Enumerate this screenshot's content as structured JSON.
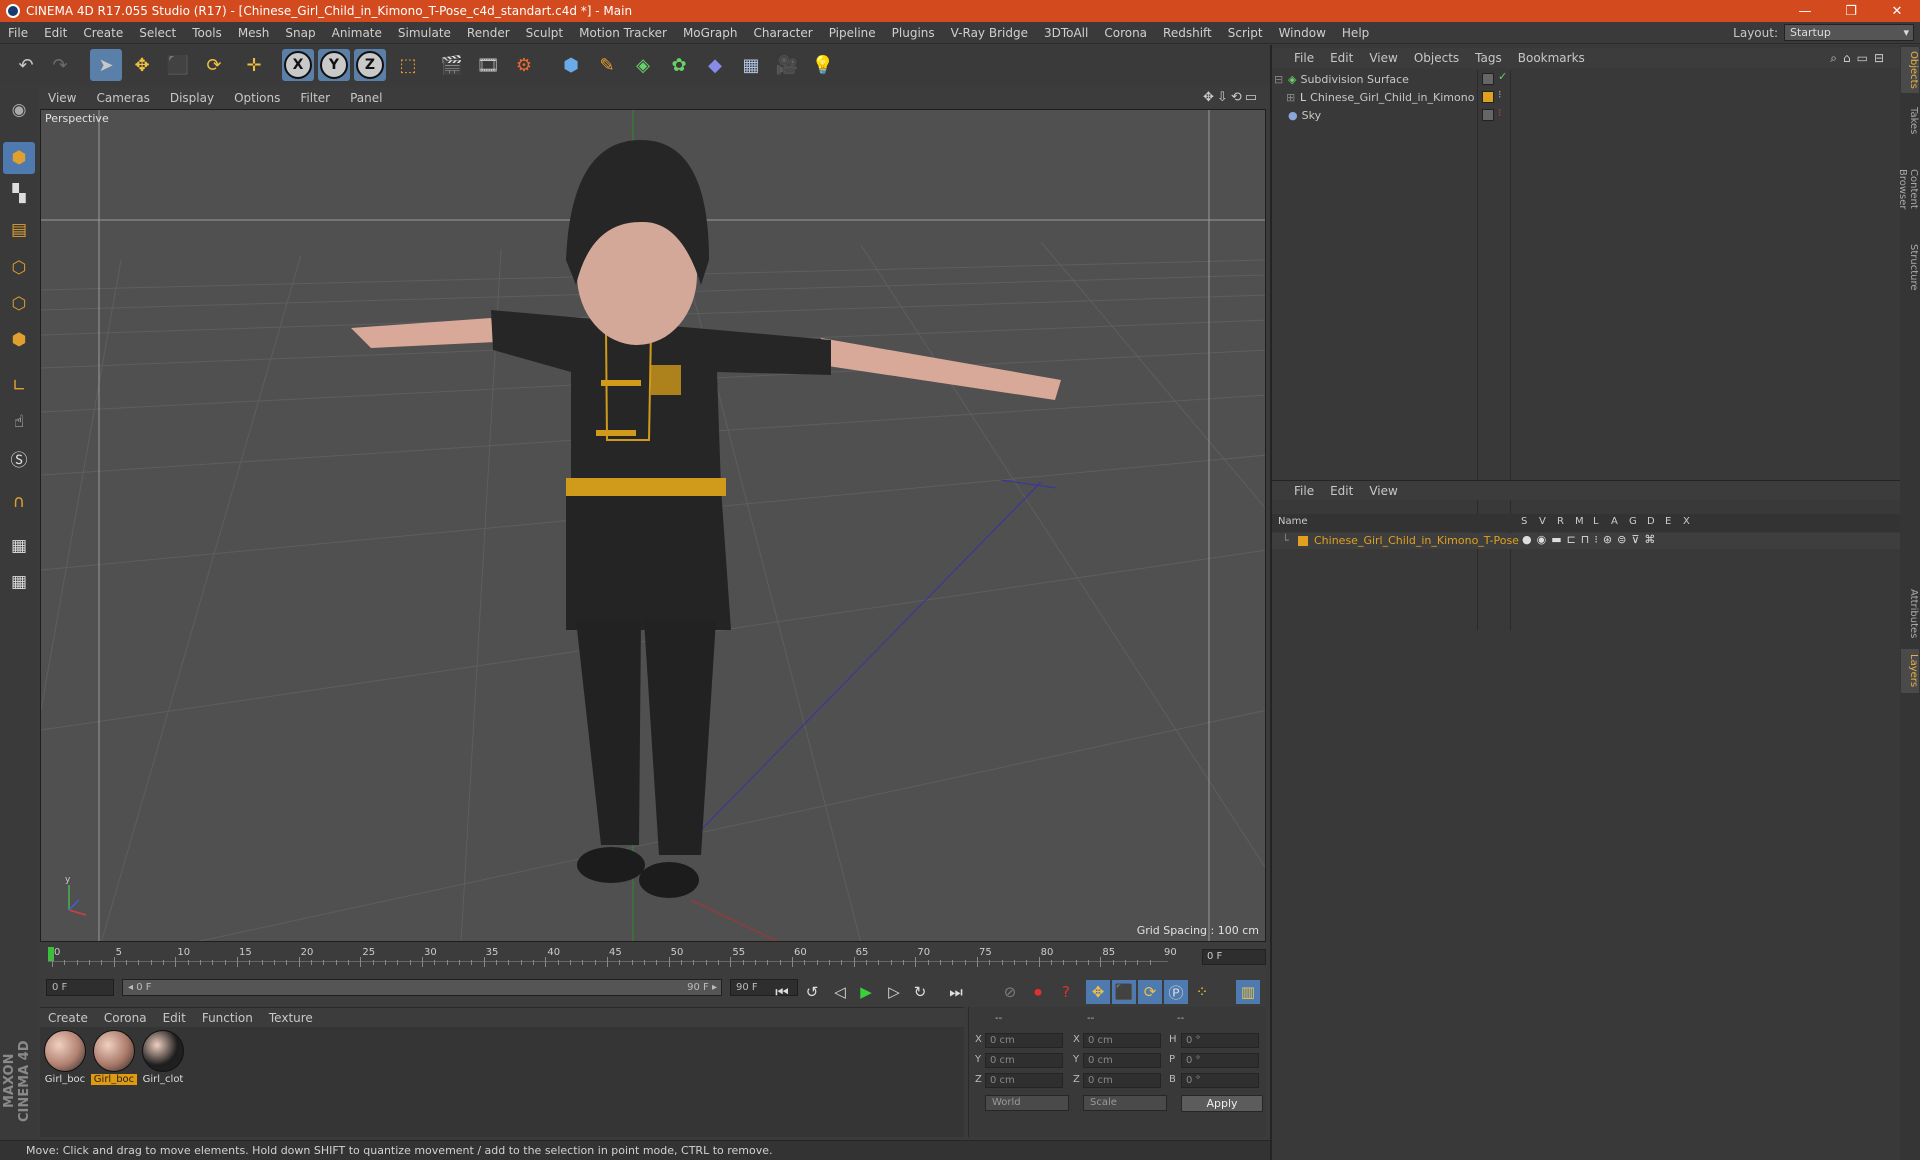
{
  "window": {
    "title": "CINEMA 4D R17.055 Studio (R17) - [Chinese_Girl_Child_in_Kimono_T-Pose_c4d_standart.c4d *] - Main",
    "minimize": "—",
    "restore": "❐",
    "close": "✕"
  },
  "menu": [
    "File",
    "Edit",
    "Create",
    "Select",
    "Tools",
    "Mesh",
    "Snap",
    "Animate",
    "Simulate",
    "Render",
    "Sculpt",
    "Motion Tracker",
    "MoGraph",
    "Character",
    "Pipeline",
    "Plugins",
    "V-Ray Bridge",
    "3DToAll",
    "Corona",
    "Redshift",
    "Script",
    "Window",
    "Help"
  ],
  "layout": {
    "label": "Layout:",
    "value": "Startup"
  },
  "icons": {
    "undo": "↶",
    "redo": "↷",
    "select": "➤",
    "move": "✥",
    "scale": "⬛",
    "rotate": "⟳",
    "live": "✛",
    "x_axis": "X",
    "y_axis": "Y",
    "z_axis": "Z",
    "coord": "⬚",
    "render_view": "🎬",
    "render_pic": "🎞",
    "render_settings": "⚙",
    "cube": "⬢",
    "pen": "✎",
    "subdiv": "◈",
    "mograph": "✿",
    "deformer": "◆",
    "floor": "▦",
    "camera": "🎥",
    "light": "💡"
  },
  "viewport": {
    "menu": [
      "View",
      "Cameras",
      "Display",
      "Options",
      "Filter",
      "Panel"
    ],
    "nav_icons": "✥⇩⟲▭",
    "label": "Perspective",
    "grid_spacing": "Grid Spacing : 100 cm"
  },
  "timeline": {
    "ticks": [
      "0",
      "5",
      "10",
      "15",
      "20",
      "25",
      "30",
      "35",
      "40",
      "45",
      "50",
      "55",
      "60",
      "65",
      "70",
      "75",
      "80",
      "85",
      "90"
    ],
    "current_frame": "0 F"
  },
  "transport": {
    "start": "0 F",
    "range_start": "◂ 0 F",
    "range_end": "90 F ▸",
    "end": "90 F"
  },
  "materials": {
    "menu": [
      "Create",
      "Corona",
      "Edit",
      "Function",
      "Texture"
    ],
    "items": [
      {
        "label": "Girl_boc",
        "color": "#b08070"
      },
      {
        "label": "Girl_boc",
        "color": "#a87868"
      },
      {
        "label": "Girl_clot",
        "color": "#1e1e1e"
      }
    ]
  },
  "coordinates": {
    "header": [
      "--",
      "--",
      "--"
    ],
    "rows": [
      {
        "a": "X",
        "av": "0 cm",
        "b": "X",
        "bv": "0 cm",
        "c": "H",
        "cv": "0 °"
      },
      {
        "a": "Y",
        "av": "0 cm",
        "b": "Y",
        "bv": "0 cm",
        "c": "P",
        "cv": "0 °"
      },
      {
        "a": "Z",
        "av": "0 cm",
        "b": "Z",
        "bv": "0 cm",
        "c": "B",
        "cv": "0 °"
      }
    ],
    "world": "World",
    "scale": "Scale",
    "apply": "Apply"
  },
  "status": "Move: Click and drag to move elements. Hold down SHIFT to quantize movement / add to the selection in point mode, CTRL to remove.",
  "objects_panel": {
    "menu": [
      "File",
      "Edit",
      "View",
      "Objects",
      "Tags",
      "Bookmarks"
    ],
    "items": [
      {
        "name": "Subdivision Surface",
        "color": "#6ad06a"
      },
      {
        "name": "Chinese_Girl_Child_in_Kimono",
        "color": "#d8d8d8"
      },
      {
        "name": "Sky",
        "color": "#8aa6d8"
      }
    ]
  },
  "layers_panel": {
    "menu": [
      "File",
      "Edit",
      "View"
    ],
    "columns": [
      "Name",
      "S",
      "V",
      "R",
      "M",
      "L",
      "A",
      "G",
      "D",
      "E",
      "X"
    ],
    "layer": "Chinese_Girl_Child_in_Kimono_T-Pose",
    "layer_color": "#e0a020"
  },
  "side_tabs": [
    "Objects",
    "Takes",
    "Content Browser",
    "Structure",
    "Attributes",
    "Layers"
  ],
  "brand": "MAXON CINEMA 4D"
}
